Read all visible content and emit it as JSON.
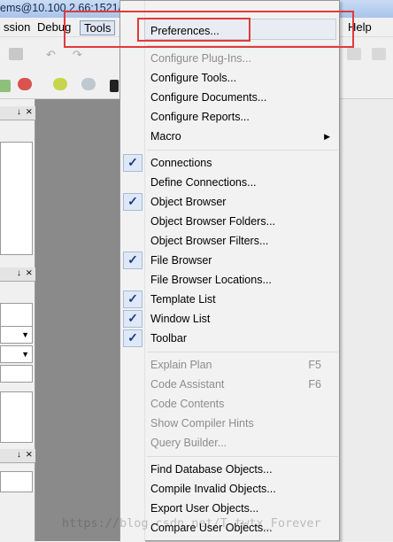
{
  "window": {
    "title": "ems@10.100.2.66:1521/"
  },
  "menubar": {
    "session": "ssion",
    "debug": "Debug",
    "tools": "Tools",
    "help": "Help"
  },
  "left_panel": {
    "header_1": "↓ ⨯",
    "header_2": "↓ ⨯",
    "header_3": "↓ ⨯"
  },
  "menu": {
    "preferences": "Preferences...",
    "configure_plugins": "Configure Plug-Ins...",
    "configure_tools": "Configure Tools...",
    "configure_documents": "Configure Documents...",
    "configure_reports": "Configure Reports...",
    "macro": "Macro",
    "connections": "Connections",
    "define_connections": "Define Connections...",
    "object_browser": "Object Browser",
    "object_browser_folders": "Object Browser Folders...",
    "object_browser_filters": "Object Browser Filters...",
    "file_browser": "File Browser",
    "file_browser_locations": "File Browser Locations...",
    "template_list": "Template List",
    "window_list": "Window List",
    "toolbar": "Toolbar",
    "explain_plan": "Explain Plan",
    "explain_plan_shortcut": "F5",
    "code_assistant": "Code Assistant",
    "code_assistant_shortcut": "F6",
    "code_contents": "Code Contents",
    "show_compiler_hints": "Show Compiler Hints",
    "query_builder": "Query Builder...",
    "find_database_objects": "Find Database Objects...",
    "compile_invalid_objects": "Compile Invalid Objects...",
    "export_user_objects": "Export User Objects...",
    "compare_user_objects": "Compare User Objects..."
  },
  "checks": {
    "connections": true,
    "object_browser": true,
    "file_browser": true,
    "template_list": true,
    "window_list": true,
    "toolbar": true
  },
  "watermark": "https://blog.csdn.net/T_twtx_Forever",
  "highlight_color": "#e23a3a",
  "check_color": "#1b3a8a"
}
